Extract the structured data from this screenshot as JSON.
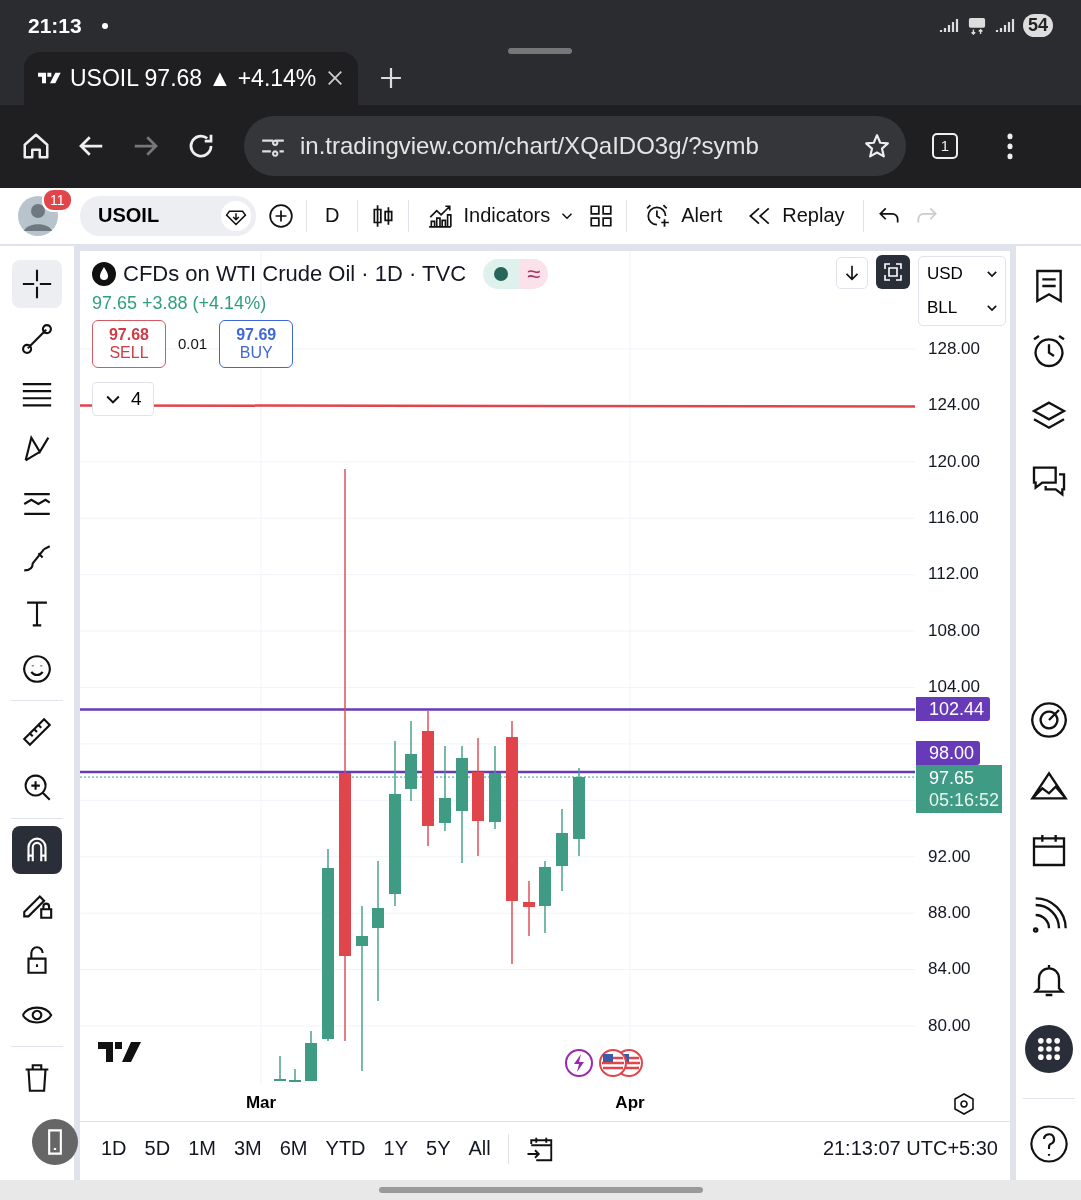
{
  "status_bar": {
    "time": "21:13",
    "battery": "54"
  },
  "browser_tab": {
    "title": "USOIL 97.68 ▲ +4.14%"
  },
  "address_bar": {
    "url": "in.tradingview.com/chart/XQaIDO3g/?symb",
    "tab_count": "1"
  },
  "toolbar": {
    "notification_count": "11",
    "symbol": "USOIL",
    "interval": "D",
    "indicators": "Indicators",
    "alert": "Alert",
    "replay": "Replay"
  },
  "drawing_tools": [
    {
      "selected": true
    },
    {
      "selected": false
    },
    {
      "selected": false
    },
    {
      "selected": false
    },
    {
      "selected": false
    },
    {
      "selected": false
    },
    {
      "selected": false
    },
    {
      "selected": false
    }
  ],
  "utility_tools": [
    {
      "on": false
    },
    {
      "on": false
    },
    {
      "on": true
    },
    {
      "on": false
    },
    {
      "on": false
    },
    {
      "on": false
    }
  ],
  "legend": {
    "title": "CFDs on WTI Crude Oil · 1D · TVC",
    "market_status": "≈",
    "quote": "97.65 +3.88 (+4.14%)",
    "sell": {
      "price": "97.68",
      "label": "SELL"
    },
    "spread": "0.01",
    "buy": {
      "price": "97.69",
      "label": "BUY"
    },
    "indicator_count": "4"
  },
  "scale": {
    "currency": "USD",
    "unit": "BLL"
  },
  "price_axis": [
    "128.00",
    "124.00",
    "120.00",
    "116.00",
    "112.00",
    "108.00",
    "104.00",
    "92.00",
    "88.00",
    "84.00",
    "80.00"
  ],
  "price_tags": [
    "102.44",
    "98.00"
  ],
  "last_price": {
    "value": "97.65",
    "countdown": "05:16:52"
  },
  "time_axis": [
    "Mar",
    "Apr"
  ],
  "ranges": [
    "1D",
    "5D",
    "1M",
    "3M",
    "6M",
    "YTD",
    "1Y",
    "5Y",
    "All"
  ],
  "clock": "21:13:07 UTC+5:30"
}
